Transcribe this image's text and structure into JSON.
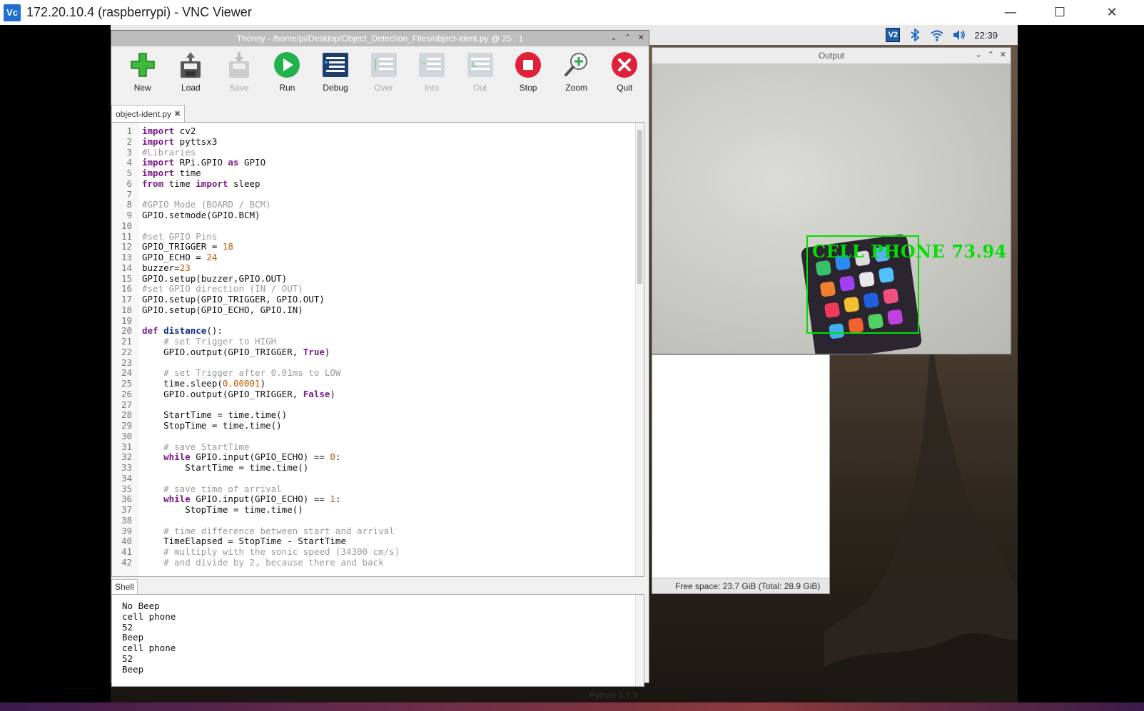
{
  "vnc": {
    "logo": "Vc",
    "title": "172.20.10.4 (raspberrypi) - VNC Viewer",
    "controls": {
      "minimize": "—",
      "maximize": "☐",
      "close": "✕"
    }
  },
  "taskbar": {
    "clock": "22:39",
    "icons": [
      "vnc-icon",
      "bluetooth-icon",
      "wifi-icon",
      "volume-icon"
    ]
  },
  "output_window": {
    "title": "Output",
    "detection_label": "CELL PHONE 73.94"
  },
  "file_manager": {
    "status": "Free space: 23.7 GiB (Total: 28.9 GiB)"
  },
  "thonny": {
    "title": "Thonny  -  /home/pi/Desktop/Object_Detection_Files/object-ident.py  @  25 : 1",
    "toolbar": [
      {
        "label": "New",
        "enabled": true
      },
      {
        "label": "Load",
        "enabled": true
      },
      {
        "label": "Save",
        "enabled": false
      },
      {
        "label": "Run",
        "enabled": true
      },
      {
        "label": "Debug",
        "enabled": true
      },
      {
        "label": "Over",
        "enabled": false
      },
      {
        "label": "Into",
        "enabled": false
      },
      {
        "label": "Out",
        "enabled": false
      },
      {
        "label": "Stop",
        "enabled": true
      },
      {
        "label": "Zoom",
        "enabled": true
      },
      {
        "label": "Quit",
        "enabled": true
      }
    ],
    "tab": "object-ident.py",
    "code_lines": [
      "import cv2",
      "import pyttsx3",
      "#Libraries",
      "import RPi.GPIO as GPIO",
      "import time",
      "from time import sleep",
      "",
      "#GPIO Mode (BOARD / BCM)",
      "GPIO.setmode(GPIO.BCM)",
      "",
      "#set GPIO Pins",
      "GPIO_TRIGGER = 18",
      "GPIO_ECHO = 24",
      "buzzer=23",
      "GPIO.setup(buzzer,GPIO.OUT)",
      "#set GPIO direction (IN / OUT)",
      "GPIO.setup(GPIO_TRIGGER, GPIO.OUT)",
      "GPIO.setup(GPIO_ECHO, GPIO.IN)",
      "",
      "def distance():",
      "    # set Trigger to HIGH",
      "    GPIO.output(GPIO_TRIGGER, True)",
      "",
      "    # set Trigger after 0.01ms to LOW",
      "    time.sleep(0.00001)",
      "    GPIO.output(GPIO_TRIGGER, False)",
      "",
      "    StartTime = time.time()",
      "    StopTime = time.time()",
      "",
      "    # save StartTime",
      "    while GPIO.input(GPIO_ECHO) == 0:",
      "        StartTime = time.time()",
      "",
      "    # save time of arrival",
      "    while GPIO.input(GPIO_ECHO) == 1:",
      "        StopTime = time.time()",
      "",
      "    # time difference between start and arrival",
      "    TimeElapsed = StopTime - StartTime",
      "    # multiply with the sonic speed (34300 cm/s)",
      "    # and divide by 2, because there and back"
    ],
    "shell_tab": "Shell",
    "shell_lines": [
      "No Beep",
      "cell phone",
      "52",
      "Beep",
      "cell phone",
      "52",
      "Beep"
    ],
    "status": "Python 3.7.3"
  }
}
